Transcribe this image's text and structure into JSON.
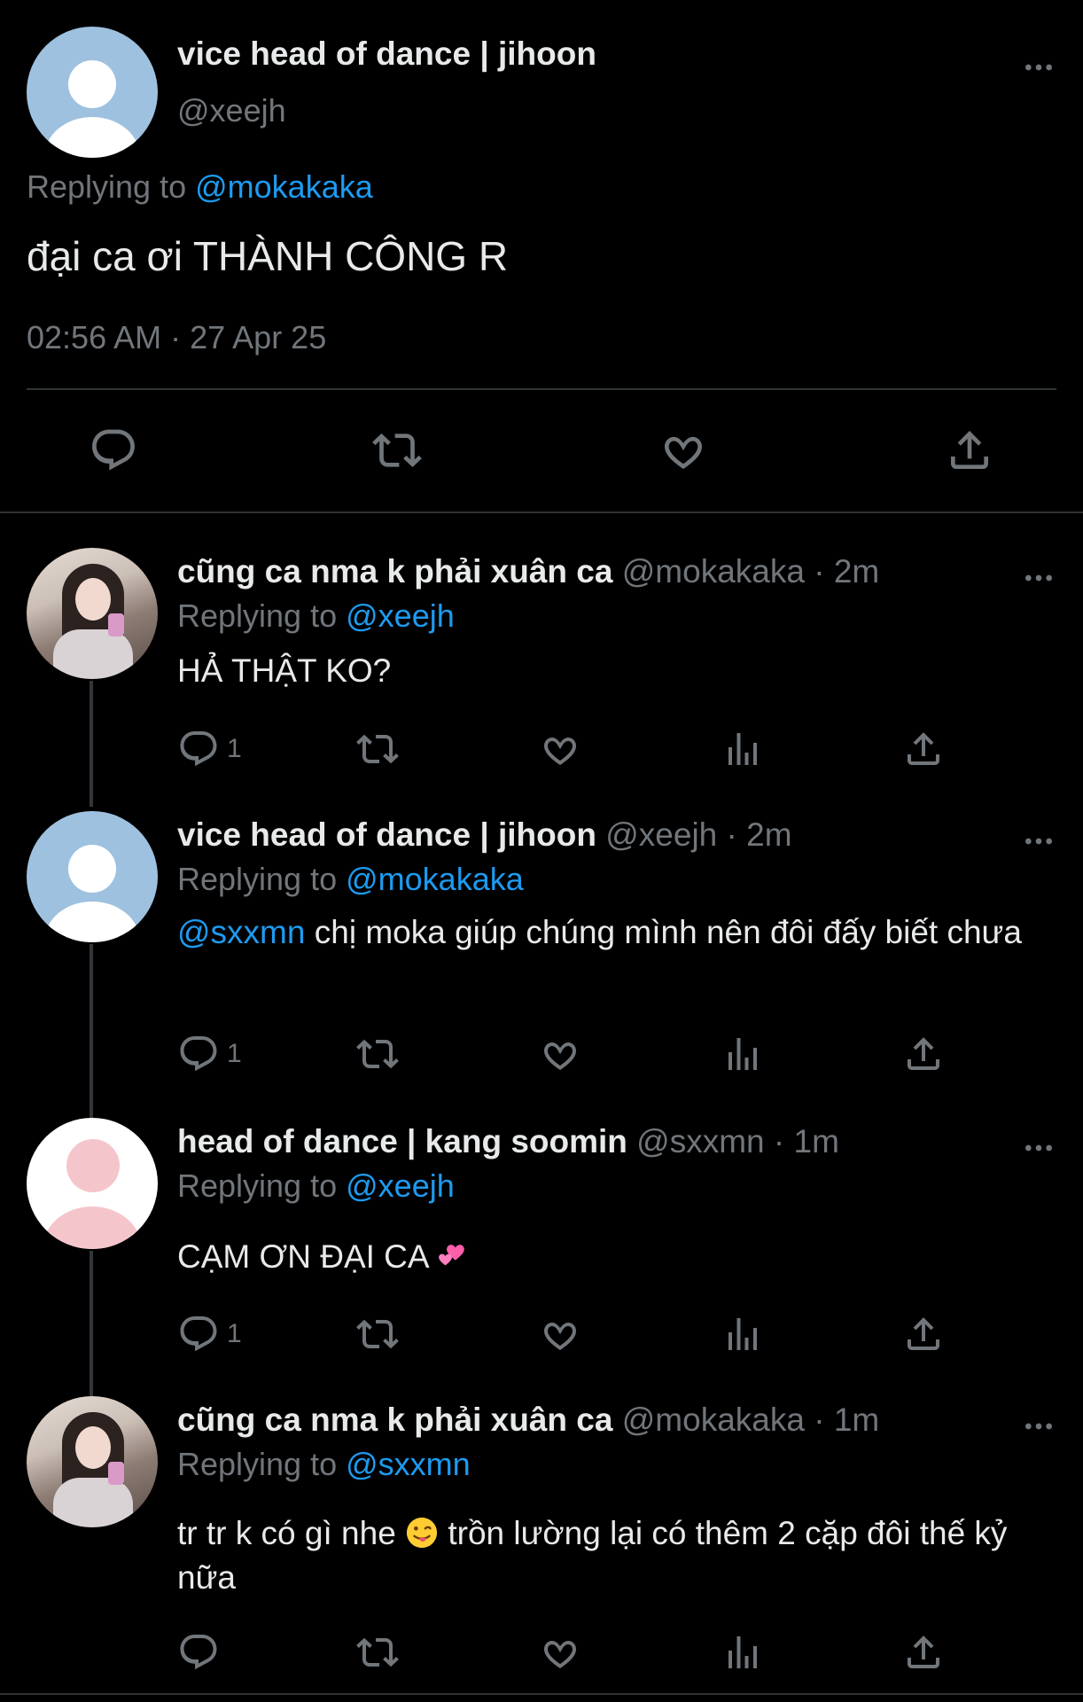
{
  "main_tweet": {
    "display_name": "vice head of dance | jihoon",
    "handle": "@xeejh",
    "replying_prefix": "Replying to",
    "replying_to": "@mokakaka",
    "text": "đại ca ơi THÀNH CÔNG R",
    "timestamp": "02:56 AM · 27 Apr 25",
    "avatar": "default-avatar"
  },
  "replies": [
    {
      "display_name": "cũng ca nma k phải xuân ca",
      "handle": "@mokakaka",
      "time": "· 2m",
      "replying_prefix": "Replying to",
      "replying_to": "@xeejh",
      "text": "HẢ THẬT KO?",
      "reply_count": "1",
      "avatar": "photo-avatar"
    },
    {
      "display_name": "vice head of dance | jihoon",
      "handle": "@xeejh",
      "time": "· 2m",
      "replying_prefix": "Replying to",
      "replying_to": "@mokakaka",
      "mention": "@sxxmn",
      "text": " chị moka giúp chúng mình nên đôi đấy biết chưa",
      "reply_count": "1",
      "avatar": "default-avatar"
    },
    {
      "display_name": "head of dance | kang soomin",
      "handle": "@sxxmn",
      "time": "· 1m",
      "replying_prefix": "Replying to",
      "replying_to": "@xeejh",
      "text": "CẠM ƠN ĐẠI CA ",
      "emoji": "two-hearts-emoji",
      "reply_count": "1",
      "avatar": "pink-default-avatar"
    },
    {
      "display_name": "cũng ca nma k phải xuân ca",
      "handle": "@mokakaka",
      "time": "· 1m",
      "replying_prefix": "Replying to",
      "replying_to": "@sxxmn",
      "text_a": "tr tr k có gì nhe ",
      "emoji": "tongue-face-emoji",
      "text_b": "  trồn lường lại có thêm 2 cặp đôi thế kỷ nữa",
      "avatar": "photo-avatar"
    }
  ],
  "icons": [
    "reply-icon",
    "retweet-icon",
    "like-icon",
    "share-icon",
    "views-icon",
    "more-icon"
  ],
  "colors": {
    "background": "#000000",
    "text": "#e7e9ea",
    "secondary": "#71767b",
    "link": "#1d9bf0",
    "divider": "#2f3336"
  }
}
